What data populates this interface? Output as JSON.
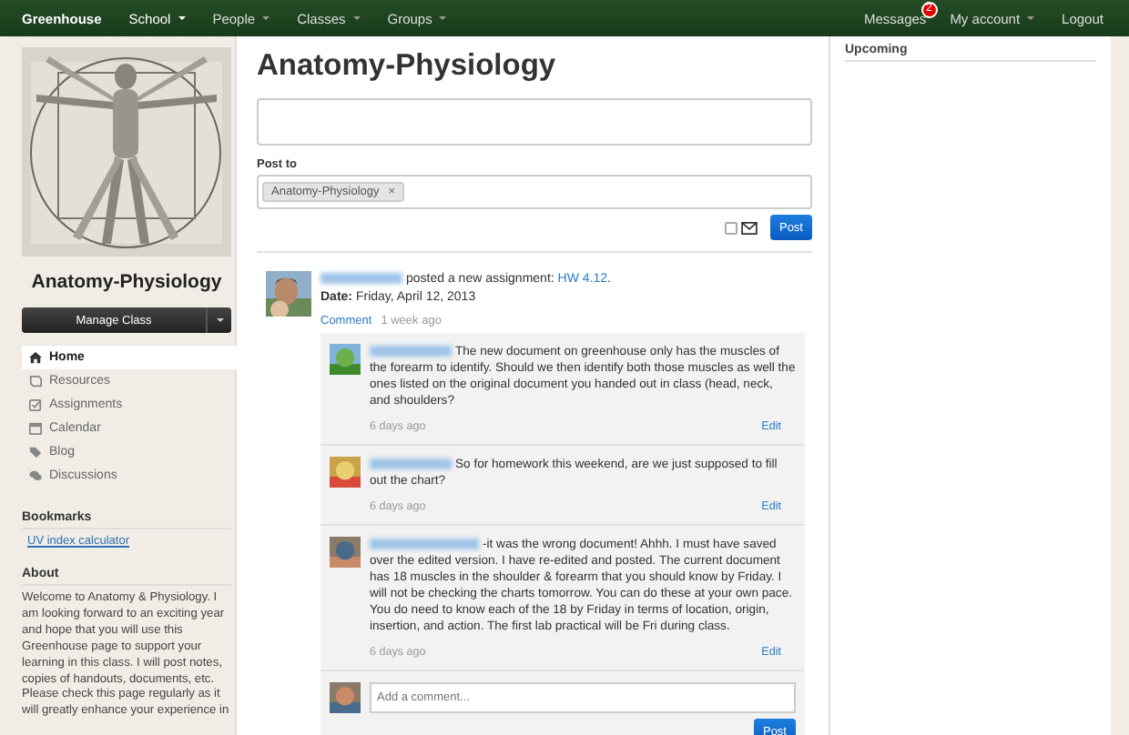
{
  "navbar": {
    "brand": "Greenhouse",
    "menus": [
      {
        "label": "School",
        "selected": true
      },
      {
        "label": "People",
        "selected": false
      },
      {
        "label": "Classes",
        "selected": false
      },
      {
        "label": "Groups",
        "selected": false
      }
    ],
    "messages": {
      "label": "Messages",
      "badge": "2"
    },
    "account": "My account",
    "logout": "Logout"
  },
  "sidebar": {
    "class_title": "Anatomy-Physiology",
    "manage_button": "Manage Class",
    "nav": [
      {
        "label": "Home",
        "selected": true
      },
      {
        "label": "Resources",
        "selected": false
      },
      {
        "label": "Assignments",
        "selected": false
      },
      {
        "label": "Calendar",
        "selected": false
      },
      {
        "label": "Blog",
        "selected": false
      },
      {
        "label": "Discussions",
        "selected": false
      }
    ],
    "bookmarks": {
      "heading": "Bookmarks",
      "links": [
        "UV index calculator"
      ]
    },
    "about": {
      "heading": "About",
      "text": "Welcome to Anatomy & Physiology. I am looking forward to an exciting year and hope that you will use this Greenhouse page to support your learning in this class. I will post notes, copies of handouts, documents, etc. Please check this page regularly as it will greatly enhance your experience in"
    }
  },
  "main": {
    "title": "Anatomy-Physiology",
    "post_to_label": "Post to",
    "tag": "Anatomy-Physiology",
    "tag_remove": "×",
    "email_notify": false,
    "post_button": "Post",
    "feed_item": {
      "action": "posted a new assignment:",
      "link": "HW 4.12",
      "end": ".",
      "date": "**Date:** Friday, April 12, 2013",
      "comment_link": "Comment",
      "time": "1 week ago",
      "comments": [
        {
          "text": "The new document on greenhouse only has the muscles of the forearm to identify. Should we then identify both those muscles as well the ones listed on the original document you handed out in class (head, neck, and shoulders?",
          "time": "6 days ago",
          "edit": "Edit"
        },
        {
          "text": "So for homework this weekend, are we just supposed to fill out the chart?",
          "time": "6 days ago",
          "edit": "Edit"
        },
        {
          "text": "-it was the wrong document! Ahhh. I must have saved over the edited version. I have re-edited and posted. The current document has 18 muscles in the shoulder & forearm that you should know by Friday. I will not be checking the charts tomorrow. You can do these at your own pace. You do need to know each of the 18 by Friday in terms of location, origin, insertion, and action. The first lab practical will be Fri during class.",
          "time": "6 days ago",
          "edit": "Edit"
        }
      ],
      "reply": {
        "placeholder": "Add a comment...",
        "button": "Post"
      }
    }
  },
  "upcoming": {
    "heading": "Upcoming"
  }
}
